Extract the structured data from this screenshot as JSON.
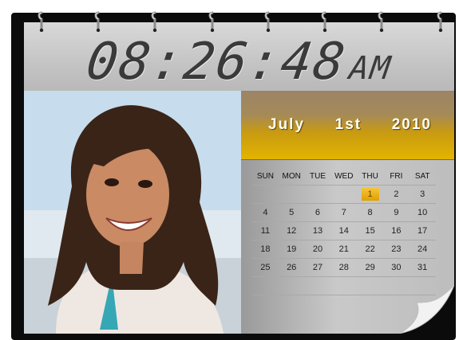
{
  "clock": {
    "time": "08:26:48",
    "ampm": "AM"
  },
  "calendar": {
    "month": "July",
    "day": "1st",
    "year": "2010",
    "weekdays": [
      "SUN",
      "MON",
      "TUE",
      "WED",
      "THU",
      "FRI",
      "SAT"
    ],
    "today": "1",
    "weeks": [
      [
        "",
        "",
        "",
        "",
        "1",
        "2",
        "3"
      ],
      [
        "4",
        "5",
        "6",
        "7",
        "8",
        "9",
        "10"
      ],
      [
        "11",
        "12",
        "13",
        "14",
        "15",
        "16",
        "17"
      ],
      [
        "18",
        "19",
        "20",
        "21",
        "22",
        "23",
        "24"
      ],
      [
        "25",
        "26",
        "27",
        "28",
        "29",
        "30",
        "31"
      ]
    ]
  },
  "colors": {
    "accent": "#e0a000",
    "panel": "#c4c4c4"
  },
  "photo": {
    "icon": "portrait-photo"
  }
}
